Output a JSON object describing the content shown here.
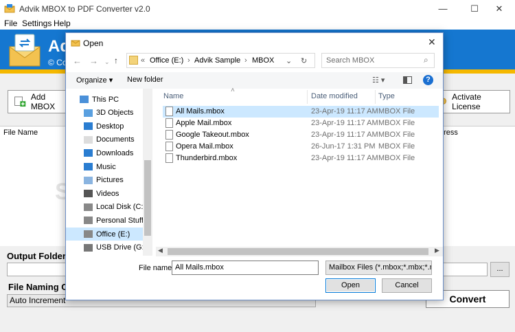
{
  "app": {
    "title": "Advik MBOX to PDF Converter v2.0",
    "menu": [
      "File",
      "Settings",
      "Help"
    ],
    "banner_title": "Adv",
    "banner_sub": "© Co",
    "add_button": "Add MBOX",
    "activate_button": "Activate License",
    "columns": {
      "file_name": "File Name",
      "progress": "gress"
    },
    "watermark_left": "S",
    "watermark_right": "t",
    "output_folder_label": "Output Folder",
    "browse_label": "...",
    "naming_label": "File Naming Op",
    "naming_value": "Auto Increment",
    "convert_button": "Convert"
  },
  "dialog": {
    "title": "Open",
    "address": {
      "prefix": "«",
      "crumbs": [
        "Office (E:)",
        "Advik Sample",
        "MBOX"
      ]
    },
    "search_placeholder": "Search MBOX",
    "organize": "Organize",
    "new_folder": "New folder",
    "nav_items": [
      {
        "label": "This PC",
        "icon": "computer-icon",
        "level": 0
      },
      {
        "label": "3D Objects",
        "icon": "cube-icon",
        "level": 1
      },
      {
        "label": "Desktop",
        "icon": "desktop-icon",
        "level": 1
      },
      {
        "label": "Documents",
        "icon": "documents-icon",
        "level": 1
      },
      {
        "label": "Downloads",
        "icon": "download-icon",
        "level": 1
      },
      {
        "label": "Music",
        "icon": "music-icon",
        "level": 1
      },
      {
        "label": "Pictures",
        "icon": "pictures-icon",
        "level": 1
      },
      {
        "label": "Videos",
        "icon": "video-icon",
        "level": 1
      },
      {
        "label": "Local Disk (C:)",
        "icon": "drive-icon",
        "level": 1
      },
      {
        "label": "Personal Stuff (E",
        "icon": "drive-icon",
        "level": 1
      },
      {
        "label": "Office (E:)",
        "icon": "drive-icon",
        "level": 1,
        "selected": true
      },
      {
        "label": "USB Drive (G:)",
        "icon": "usb-icon",
        "level": 1
      }
    ],
    "columns": {
      "name": "Name",
      "date": "Date modified",
      "type": "Type"
    },
    "files": [
      {
        "name": "All Mails.mbox",
        "date": "23-Apr-19 11:17 AM",
        "type": "MBOX File",
        "selected": true
      },
      {
        "name": "Apple Mail.mbox",
        "date": "23-Apr-19 11:17 AM",
        "type": "MBOX File"
      },
      {
        "name": "Google Takeout.mbox",
        "date": "23-Apr-19 11:17 AM",
        "type": "MBOX File"
      },
      {
        "name": "Opera Mail.mbox",
        "date": "26-Jun-17 1:31 PM",
        "type": "MBOX File"
      },
      {
        "name": "Thunderbird.mbox",
        "date": "23-Apr-19 11:17 AM",
        "type": "MBOX File"
      }
    ],
    "filename_label": "File name:",
    "filename_value": "All Mails.mbox",
    "filetype_value": "Mailbox Files (*.mbox;*.mbx;*.n",
    "open_button": "Open",
    "cancel_button": "Cancel"
  },
  "colors": {
    "banner": "#1577d0",
    "strip": "#f5b800",
    "selection": "#cce8ff"
  }
}
